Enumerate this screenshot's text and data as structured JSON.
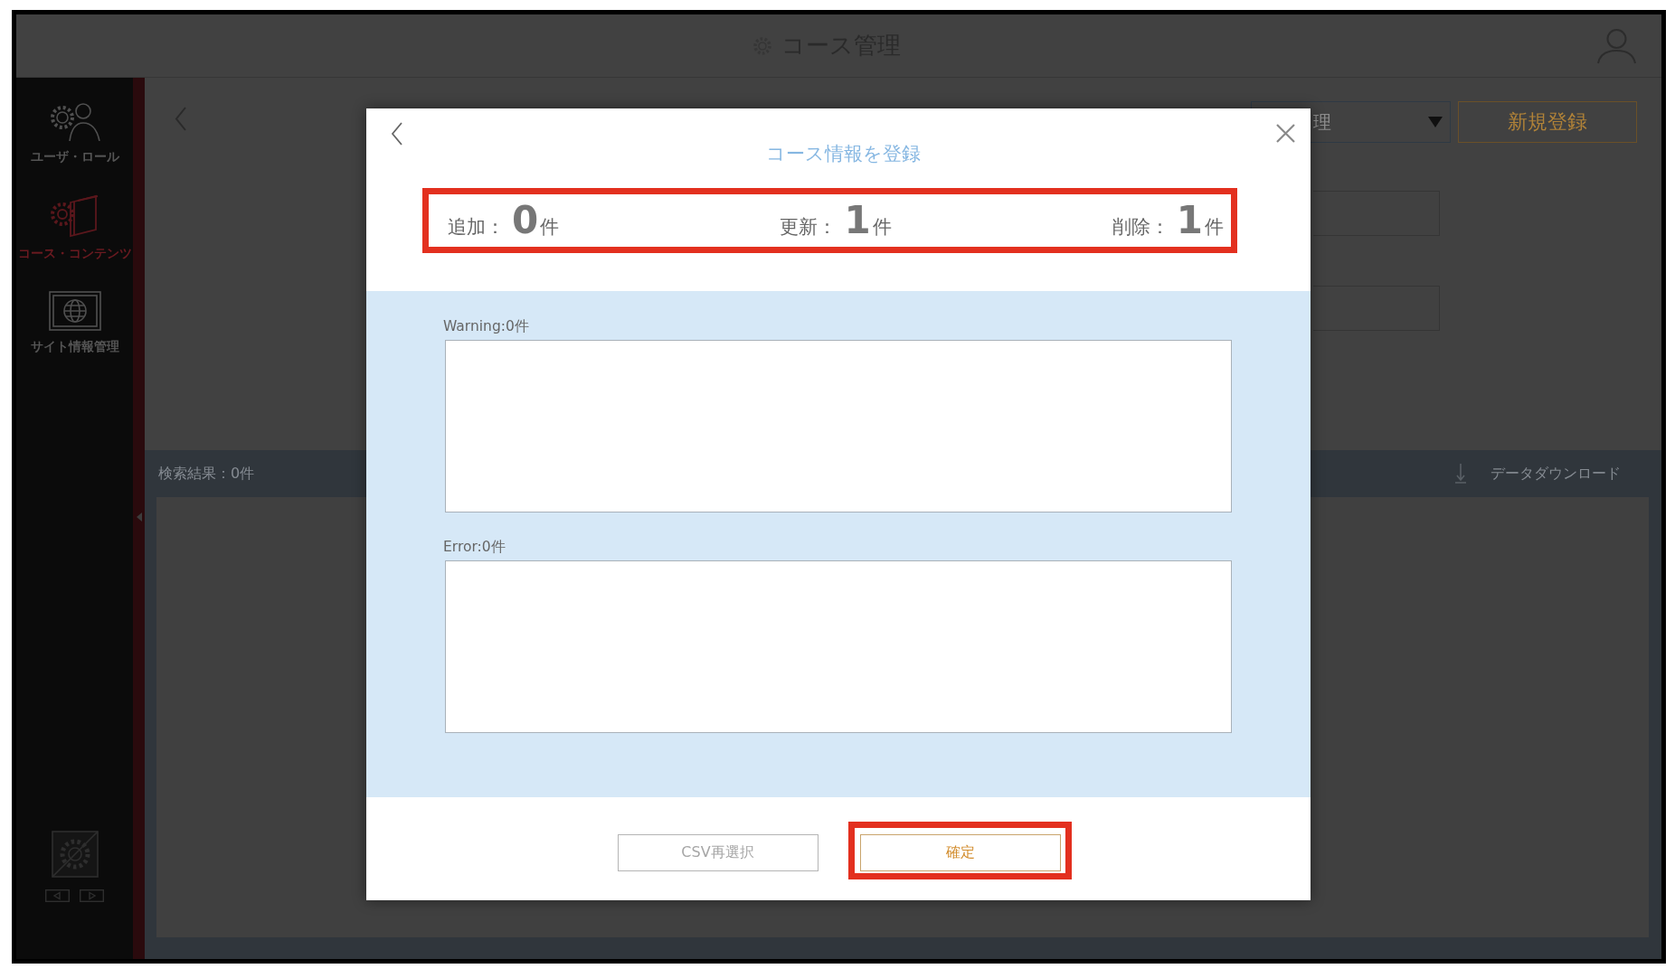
{
  "header": {
    "title": "コース管理"
  },
  "sidebar": {
    "items": [
      {
        "label": "ユーザ・ロール",
        "selected": false
      },
      {
        "label": "コース・コンテンツ",
        "selected": true
      },
      {
        "label": "サイト情報管理",
        "selected": false
      }
    ]
  },
  "toolbar": {
    "dropdown": {
      "value": "理"
    },
    "new_button": "新規登録"
  },
  "results": {
    "count": "検索結果：0件",
    "download": "データダウンロード"
  },
  "dialog": {
    "title": "コース情報を登録",
    "summary": {
      "highlighted": true,
      "items": [
        {
          "label": "追加：",
          "count": "0",
          "unit": "件"
        },
        {
          "label": "更新：",
          "count": "1",
          "unit": "件"
        },
        {
          "label": "削除：",
          "count": "1",
          "unit": "件"
        }
      ]
    },
    "logs": [
      {
        "label": "Warning:0件"
      },
      {
        "label": "Error:0件"
      }
    ],
    "buttons": [
      {
        "label": "CSV再選択",
        "kind": "secondary",
        "highlighted": false
      },
      {
        "label": "確定",
        "kind": "primary",
        "highlighted": true
      }
    ]
  }
}
